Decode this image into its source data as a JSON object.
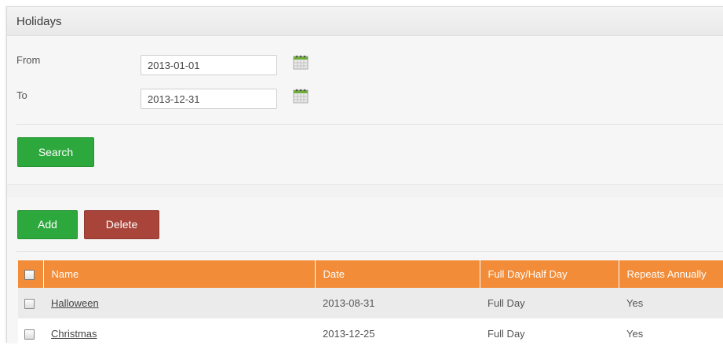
{
  "panel": {
    "title": "Holidays"
  },
  "form": {
    "from_label": "From",
    "from_value": "2013-01-01",
    "to_label": "To",
    "to_value": "2013-12-31",
    "search_label": "Search"
  },
  "actions": {
    "add_label": "Add",
    "delete_label": "Delete"
  },
  "table": {
    "headers": [
      "Name",
      "Date",
      "Full Day/Half Day",
      "Repeats Annually"
    ],
    "rows": [
      {
        "name": "Halloween",
        "date": "2013-08-31",
        "length": "Full Day",
        "repeats": "Yes"
      },
      {
        "name": "Christmas",
        "date": "2013-12-25",
        "length": "Full Day",
        "repeats": "Yes"
      }
    ]
  },
  "icons": {
    "calendar": "calendar-icon",
    "checkbox": "checkbox"
  },
  "colors": {
    "header_orange": "#f28c38",
    "button_green": "#2da83d",
    "button_red": "#a8443a",
    "panel_bg": "#f6f6f6"
  }
}
